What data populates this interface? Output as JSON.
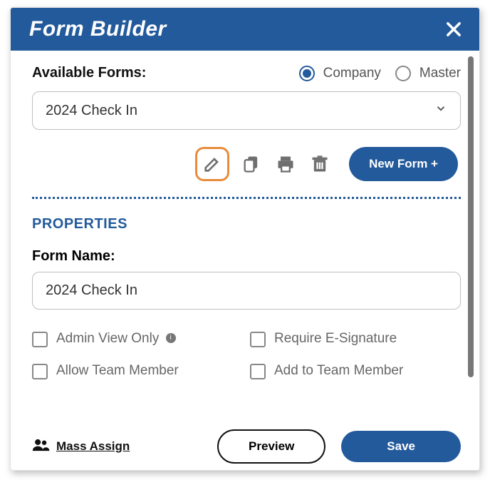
{
  "header": {
    "title": "Form Builder"
  },
  "available": {
    "label": "Available Forms:",
    "selected": "2024 Check In",
    "radios": {
      "company": "Company",
      "master": "Master",
      "selected": "company"
    }
  },
  "toolbar": {
    "new_form": "New Form +"
  },
  "properties": {
    "section_title": "PROPERTIES",
    "form_name_label": "Form Name:",
    "form_name_value": "2024 Check In",
    "checks": {
      "admin_view_only": "Admin View Only",
      "require_esig": "Require E-Signature",
      "allow_team_member": "Allow Team Member",
      "add_to_team_member": "Add to Team Member"
    }
  },
  "footer": {
    "mass_assign": "Mass Assign",
    "preview": "Preview",
    "save": "Save"
  }
}
